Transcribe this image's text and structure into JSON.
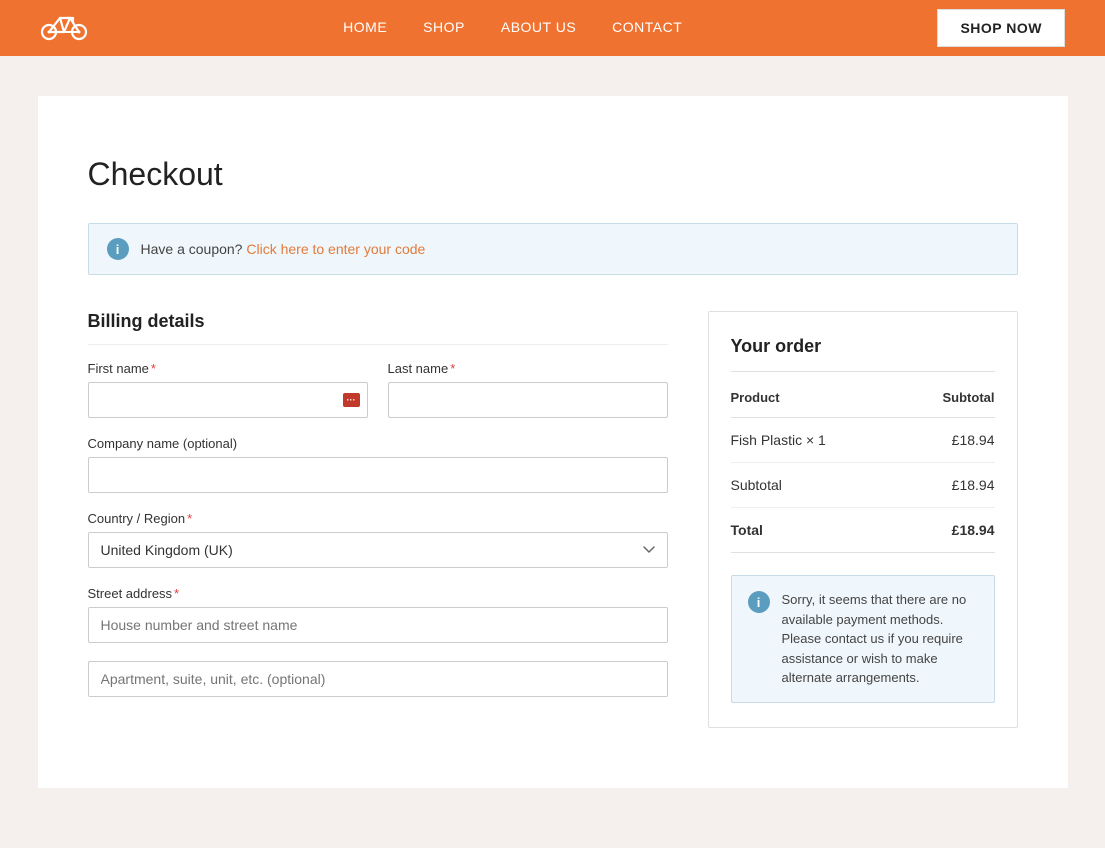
{
  "nav": {
    "logo_symbol": "🚲",
    "links": [
      {
        "label": "HOME",
        "href": "#"
      },
      {
        "label": "SHOP",
        "href": "#"
      },
      {
        "label": "ABOUT US",
        "href": "#"
      },
      {
        "label": "CONTACT",
        "href": "#"
      }
    ],
    "shop_now_label": "SHOP NOW"
  },
  "page": {
    "title": "Checkout",
    "coupon": {
      "text": "Have a coupon?",
      "link_text": "Click here to enter your code",
      "icon": "i"
    }
  },
  "billing": {
    "title": "Billing details",
    "first_name_label": "First name",
    "last_name_label": "Last name",
    "company_name_label": "Company name (optional)",
    "country_label": "Country / Region",
    "country_default": "United Kingdom (UK)",
    "street_address_label": "Street address",
    "street_address_placeholder": "House number and street name",
    "apartment_placeholder": "Apartment, suite, unit, etc. (optional)"
  },
  "order": {
    "title": "Your order",
    "col_product": "Product",
    "col_subtotal": "Subtotal",
    "items": [
      {
        "name": "Fish Plastic × 1",
        "price": "£18.94"
      }
    ],
    "subtotal_label": "Subtotal",
    "subtotal_value": "£18.94",
    "total_label": "Total",
    "total_value": "£18.94",
    "payment_info": {
      "icon": "i",
      "text": "Sorry, it seems that there are no available payment methods. Please contact us if you require assistance or wish to make alternate arrangements."
    }
  }
}
